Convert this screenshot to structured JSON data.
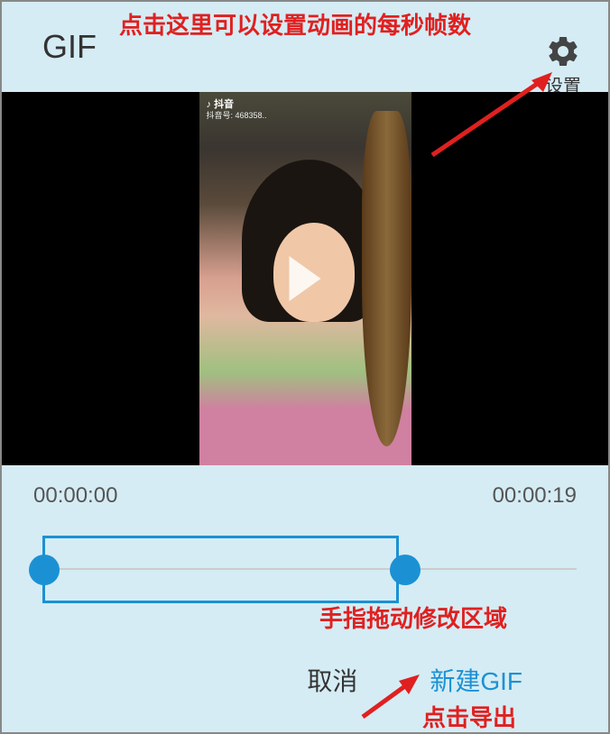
{
  "header": {
    "title": "GIF",
    "settings_label": "设置"
  },
  "video": {
    "watermark_logo": "抖音",
    "watermark_id": "抖音号: 468358.."
  },
  "timeline": {
    "start_time": "00:00:00",
    "end_time": "00:00:19"
  },
  "buttons": {
    "cancel": "取消",
    "create": "新建GIF"
  },
  "annotations": {
    "top_hint": "点击这里可以设置动画的每秒帧数",
    "slider_hint": "手指拖动修改区域",
    "export_hint": "点击导出"
  }
}
